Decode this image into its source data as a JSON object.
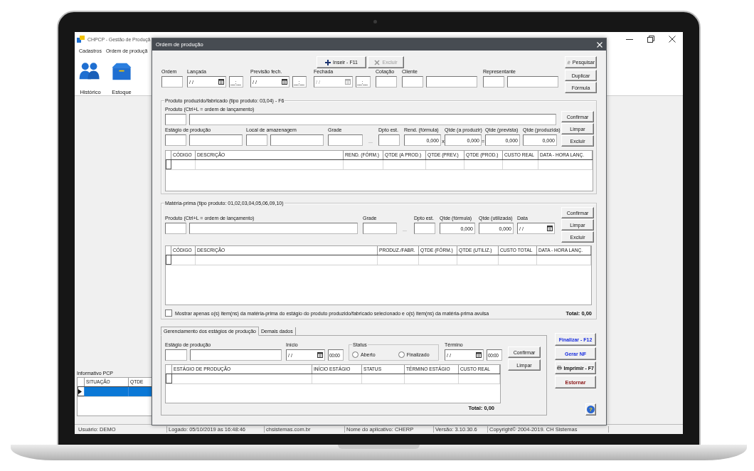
{
  "app": {
    "title": "CHPCP - Gestão de Produçã",
    "menu": [
      "Cadastros",
      "Ordem de produçã"
    ],
    "toolbar": [
      {
        "label": "Histórico",
        "kind": "people"
      },
      {
        "label": "Estoque",
        "kind": "box"
      }
    ],
    "info_panel": {
      "title": "Informativo PCP",
      "columns": [
        "SITUAÇÃO",
        "QTDE"
      ],
      "rows": [
        {
          "selected": true
        }
      ]
    },
    "status_bar": [
      "Usuário: DEMO",
      "Logado: 05/10/2019 às 16:48:46",
      "chsistemas.com.br",
      "Nome do aplicativo: CHERP",
      "Versão: 3.10.30.6",
      "Copyright© 2004-2019. CH Sistemas"
    ]
  },
  "dialog": {
    "title": "Ordem de produção",
    "actions": [
      {
        "label": "Inseir - F11",
        "kind": "insert",
        "disabled": false
      },
      {
        "label": "Excluir",
        "kind": "delete",
        "disabled": true
      }
    ],
    "side_buttons": [
      {
        "label": "Pesquisar",
        "kind": "search"
      },
      {
        "label": "Duplicar",
        "kind": "plain"
      },
      {
        "label": "Fórmula",
        "kind": "plain"
      }
    ],
    "header_fields": [
      {
        "label": "Ordem",
        "fields": [
          {
            "kind": "text"
          }
        ]
      },
      {
        "label": "Lançada",
        "fields": [
          {
            "kind": "date",
            "value": "/ /",
            "disabled": false
          },
          {
            "kind": "time",
            "value": "__:__"
          }
        ]
      },
      {
        "label": "Previsão fech.",
        "fields": [
          {
            "kind": "date",
            "value": "/ /",
            "disabled": false
          },
          {
            "kind": "time",
            "value": "__:__"
          }
        ]
      },
      {
        "label": "Fechada",
        "fields": [
          {
            "kind": "date",
            "value": "/ /",
            "disabled": true
          },
          {
            "kind": "time",
            "value": "__:__"
          }
        ]
      },
      {
        "label": "Cotação",
        "fields": [
          {
            "kind": "text"
          }
        ]
      },
      {
        "label": "Cliente",
        "fields": [
          {
            "kind": "text"
          },
          {
            "kind": "text"
          }
        ]
      },
      {
        "label": "Representante",
        "fields": [
          {
            "kind": "text"
          },
          {
            "kind": "text"
          }
        ]
      }
    ],
    "produced": {
      "title": "Produto produzido/fabricado (tipo produto: 03,04) - F6",
      "rows": [
        [
          {
            "label": "Produto (Ctrl+L = ordem de lançamento)",
            "fields": [
              {
                "kind": "text"
              },
              {
                "kind": "text"
              }
            ]
          }
        ],
        [
          {
            "label": "Estágio de produção",
            "fields": [
              {
                "kind": "text"
              },
              {
                "kind": "text"
              }
            ]
          },
          {
            "label": "Local de amazenagem",
            "fields": [
              {
                "kind": "text"
              },
              {
                "kind": "text"
              }
            ]
          },
          {
            "label": "Grade",
            "fields": [
              {
                "kind": "text"
              }
            ]
          },
          {
            "fields": [
              {
                "kind": "lookup",
                "value": "..."
              }
            ]
          },
          {
            "label": "Dpto est.",
            "fields": [
              {
                "kind": "text"
              }
            ]
          },
          {
            "label": "Rend. (fórmula)",
            "fields": [
              {
                "kind": "number",
                "value": "0,000"
              }
            ]
          },
          {
            "fields": [
              {
                "kind": "operator",
                "value": "x"
              }
            ]
          },
          {
            "label": "Qtde (a produzir)",
            "fields": [
              {
                "kind": "number",
                "value": "0,000"
              }
            ]
          },
          {
            "fields": [
              {
                "kind": "operator",
                "value": "="
              }
            ]
          },
          {
            "label": "Qtde (prevista)",
            "fields": [
              {
                "kind": "number",
                "value": "0,000"
              }
            ]
          },
          {
            "label": "Qtde (produzida)",
            "fields": [
              {
                "kind": "number",
                "value": "0,000"
              }
            ]
          }
        ]
      ],
      "buttons": [
        "Confirmar",
        "Limpar",
        "Excluir"
      ],
      "grid": {
        "columns": [
          "CÓDIGO",
          "DESCRIÇÃO",
          "REND. (FÓRM.)",
          "QTDE (A PROD.)",
          "QTDE (PREV.)",
          "QTDE (PROD.)",
          "CUSTO REAL",
          "DATA - HORA LANÇ."
        ]
      }
    },
    "material": {
      "title": "Matéria-prima (tipo produto: 01,02,03,04,05,06,09,10)",
      "rows": [
        [
          {
            "label": "Produto (Ctrl+L = ordem de lançamento)",
            "fields": [
              {
                "kind": "text"
              },
              {
                "kind": "text"
              }
            ]
          },
          {
            "label": "Grade",
            "fields": [
              {
                "kind": "text"
              }
            ]
          },
          {
            "fields": [
              {
                "kind": "lookup",
                "value": "..."
              }
            ]
          },
          {
            "label": "Dpto est.",
            "fields": [
              {
                "kind": "text"
              }
            ]
          },
          {
            "label": "Qtde (fórmula)",
            "fields": [
              {
                "kind": "number",
                "value": "0,000"
              }
            ]
          },
          {
            "label": "Qtde (utilizada)",
            "fields": [
              {
                "kind": "number",
                "value": "0,000"
              }
            ]
          },
          {
            "label": "Data",
            "fields": [
              {
                "kind": "date",
                "value": "/ /",
                "disabled": false
              }
            ]
          }
        ]
      ],
      "buttons": [
        "Confirmar",
        "Limpar",
        "Excluir"
      ],
      "grid": {
        "columns": [
          "CÓDIGO",
          "DESCRIÇÃO",
          "PRODUZ./FABR.",
          "QTDE (FÓRM.)",
          "QTDE (UTILIZ.)",
          "CUSTO TOTAL",
          "DATA - HORA LANÇ."
        ]
      },
      "option": {
        "label": "Mostrar apenas o(s) item(ns) da matéria-prima do estágio do produto produzido/fabricado selecionado e o(s) item(ns) da matéria-prima avulsa",
        "checked": false
      },
      "total": "Total: 0,00"
    },
    "stages": {
      "tabs": [
        {
          "label": "Gerenciamento dos estágios de produção",
          "selected": true
        },
        {
          "label": "Demais dados",
          "selected": false
        }
      ],
      "rows": [
        [
          {
            "label": "Estágio de produção",
            "fields": [
              {
                "kind": "text"
              },
              {
                "kind": "text"
              }
            ]
          },
          {
            "label": "Início",
            "fields": [
              {
                "kind": "date",
                "value": "/ /",
                "disabled": false
              },
              {
                "kind": "time",
                "value": "00:00"
              }
            ]
          },
          {
            "label": "Status",
            "kind": "status",
            "options": [
              {
                "label": "Aberto",
                "selected": false
              },
              {
                "label": "Finalizado",
                "selected": false
              }
            ]
          },
          {
            "label": "Término",
            "fields": [
              {
                "kind": "date",
                "value": "/ /",
                "disabled": false
              },
              {
                "kind": "time",
                "value": "00:00"
              }
            ]
          }
        ]
      ],
      "buttons": [
        "Confirmar",
        "Limpar"
      ],
      "grid": {
        "columns": [
          "ESTÁGIO DE PRODUÇÃO",
          "INÍCIO ESTÁGIO",
          "STATUS",
          "TÉRMINO ESTÁGIO",
          "CUSTO REAL"
        ]
      },
      "total": "Total: 0,00"
    },
    "side_actions": [
      {
        "label": "Finalizar - F12",
        "kind": "action"
      },
      {
        "label": "Gerar NF",
        "kind": "action"
      },
      {
        "label": "Imprimir - F7",
        "kind": "print"
      },
      {
        "label": "Estornar",
        "kind": "reverse"
      }
    ],
    "help": "?"
  }
}
